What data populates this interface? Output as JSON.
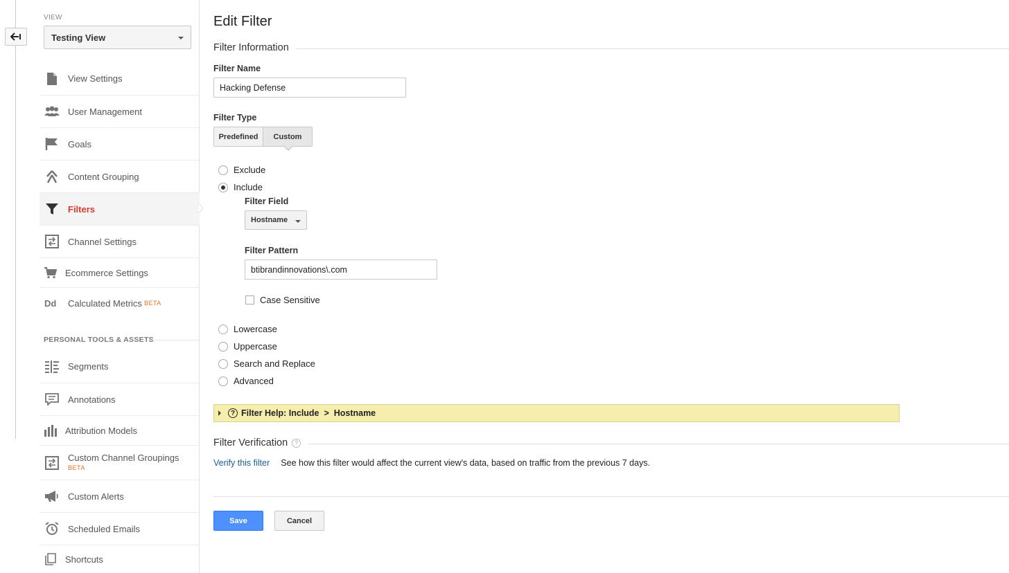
{
  "sidebar": {
    "view_label": "VIEW",
    "view_selected": "Testing View",
    "items": [
      {
        "label": "View Settings",
        "icon": "page-icon"
      },
      {
        "label": "User Management",
        "icon": "users-icon"
      },
      {
        "label": "Goals",
        "icon": "flag-icon"
      },
      {
        "label": "Content Grouping",
        "icon": "content-grouping-icon"
      },
      {
        "label": "Filters",
        "icon": "filter-icon",
        "active": true
      },
      {
        "label": "Channel Settings",
        "icon": "channel-icon"
      },
      {
        "label": "Ecommerce Settings",
        "icon": "cart-icon"
      },
      {
        "label": "Calculated Metrics",
        "icon": "dd-icon",
        "badge": "BETA"
      }
    ],
    "section_title": "PERSONAL TOOLS & ASSETS",
    "tools": [
      {
        "label": "Segments",
        "icon": "segments-icon"
      },
      {
        "label": "Annotations",
        "icon": "annotations-icon"
      },
      {
        "label": "Attribution Models",
        "icon": "attribution-icon"
      },
      {
        "label": "Custom Channel Groupings",
        "icon": "channel-icon",
        "badge": "BETA"
      },
      {
        "label": "Custom Alerts",
        "icon": "megaphone-icon"
      },
      {
        "label": "Scheduled Emails",
        "icon": "alarm-clock-icon"
      },
      {
        "label": "Shortcuts",
        "icon": "shortcuts-icon"
      }
    ]
  },
  "main": {
    "title": "Edit Filter",
    "filter_info_title": "Filter Information",
    "filter_name_label": "Filter Name",
    "filter_name_value": "Hacking Defense",
    "filter_type_label": "Filter Type",
    "type_predefined": "Predefined",
    "type_custom": "Custom",
    "options": {
      "exclude": "Exclude",
      "include": "Include",
      "lowercase": "Lowercase",
      "uppercase": "Uppercase",
      "search_replace": "Search and Replace",
      "advanced": "Advanced"
    },
    "selected_option": "Include",
    "filter_field_label": "Filter Field",
    "filter_field_value": "Hostname",
    "filter_pattern_label": "Filter Pattern",
    "filter_pattern_value": "btibrandinnovations\\.com",
    "case_sensitive_label": "Case Sensitive",
    "case_sensitive_checked": false,
    "help_bar_text": "Filter Help: Include  >  Hostname",
    "help_q": "?",
    "verification_title": "Filter Verification",
    "verify_link": "Verify this filter",
    "verify_desc": "See how this filter would affect the current view's data, based on traffic from the previous 7 days.",
    "save_label": "Save",
    "cancel_label": "Cancel"
  },
  "colors": {
    "active_red": "#d13d2e",
    "beta_orange": "#e3761f",
    "link_blue": "#1a5d99",
    "save_blue": "#4d90fe",
    "help_yellow": "#f6eeac"
  }
}
